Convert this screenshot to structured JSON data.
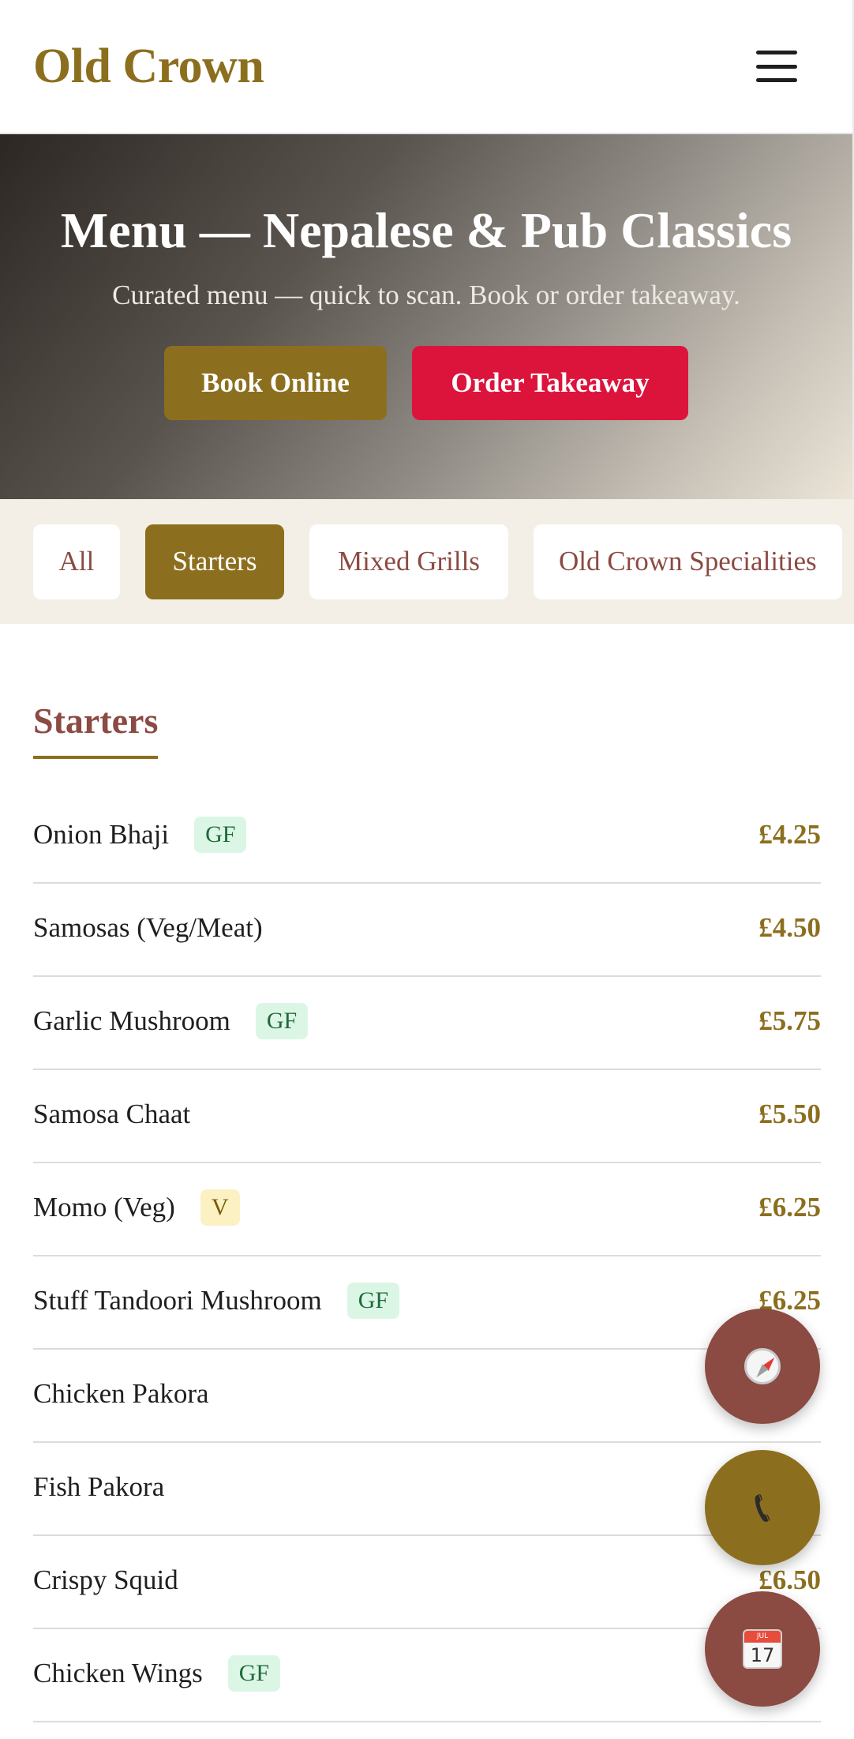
{
  "header": {
    "brand": "Old Crown",
    "menu_icon": "hamburger-menu-icon"
  },
  "hero": {
    "title": "Menu — Nepalese & Pub Classics",
    "subtitle": "Curated menu — quick to scan. Book or order takeaway.",
    "book_label": "Book Online",
    "order_label": "Order Takeaway"
  },
  "tabs": [
    {
      "label": "All",
      "active": false
    },
    {
      "label": "Starters",
      "active": true
    },
    {
      "label": "Mixed Grills",
      "active": false
    },
    {
      "label": "Old Crown Specialities",
      "active": false
    }
  ],
  "section": {
    "title": "Starters",
    "items": [
      {
        "name": "Onion Bhaji",
        "badge": "GF",
        "price": "£4.25"
      },
      {
        "name": "Samosas (Veg/Meat)",
        "badge": "",
        "price": "£4.50"
      },
      {
        "name": "Garlic Mushroom",
        "badge": "GF",
        "price": "£5.75"
      },
      {
        "name": "Samosa Chaat",
        "badge": "",
        "price": "£5.50"
      },
      {
        "name": "Momo (Veg)",
        "badge": "V",
        "price": "£6.25"
      },
      {
        "name": "Stuff Tandoori Mushroom",
        "badge": "GF",
        "price": "£6.25"
      },
      {
        "name": "Chicken Pakora",
        "badge": "",
        "price": ""
      },
      {
        "name": "Fish Pakora",
        "badge": "",
        "price": ""
      },
      {
        "name": "Crispy Squid",
        "badge": "",
        "price": "£6.50"
      },
      {
        "name": "Chicken Wings",
        "badge": "GF",
        "price": ""
      }
    ]
  },
  "fabs": {
    "directions_icon": "compass-icon",
    "call_icon": "phone-icon",
    "book_icon": "calendar-icon",
    "calendar_month": "JUL",
    "calendar_day": "17"
  },
  "colors": {
    "gold": "#8c6f1e",
    "maroon": "#8b4a42",
    "crimson": "#dc143c",
    "tabs_bg": "#f3efe6"
  }
}
